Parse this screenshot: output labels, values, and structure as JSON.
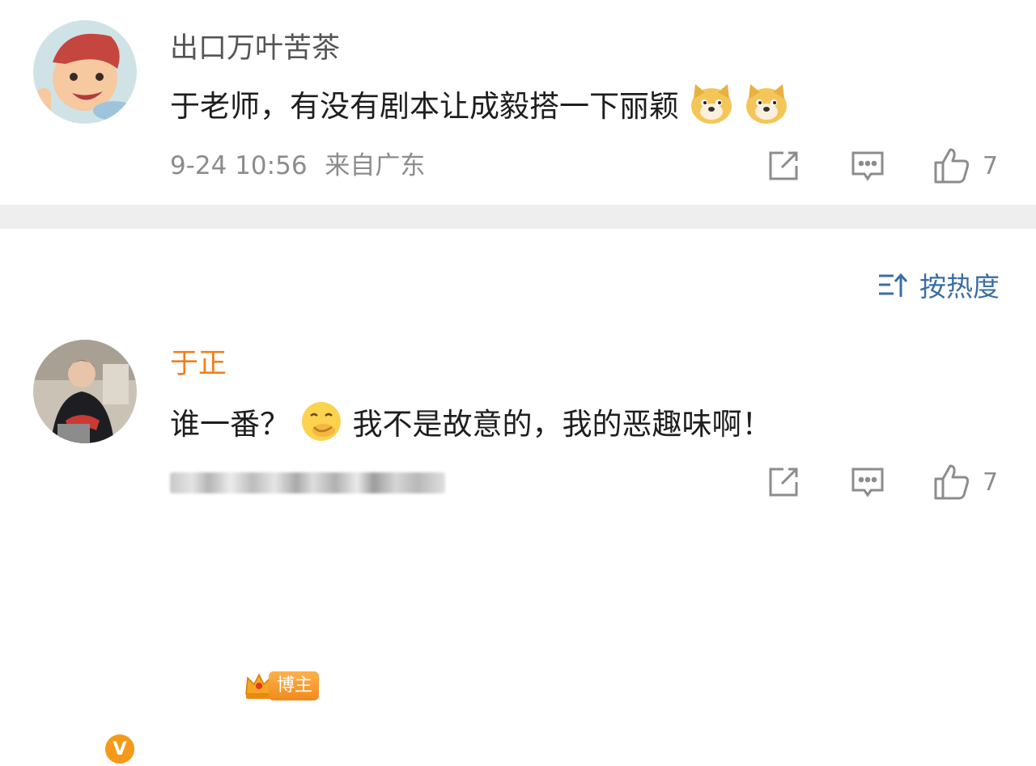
{
  "comment1": {
    "username": "出口万叶苦茶",
    "text": "于老师，有没有剧本让成毅搭一下丽颖",
    "emojis": [
      "doge-emoji",
      "doge-emoji"
    ],
    "date": "9-24 10:56",
    "location": "来自广东",
    "like_count": "7"
  },
  "sort": {
    "label": "按热度"
  },
  "comment2": {
    "username": "于正",
    "badge_label": "博主",
    "text_before": "谁一番？",
    "emoji": "smirk-emoji",
    "text_after": "我不是故意的，我的恶趣味啊！",
    "meta_obscured": "",
    "like_count": "7"
  },
  "colors": {
    "username_gray": "#555555",
    "username_orange": "#f07f1a",
    "meta_gray": "#8c8c8c",
    "sort_blue": "#3b6ea3",
    "divider": "#eeeeee"
  }
}
